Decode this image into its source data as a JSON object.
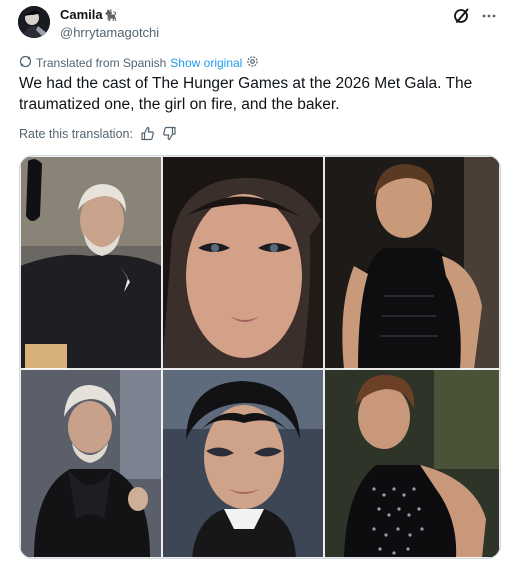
{
  "post": {
    "author": {
      "display_name": "Camila",
      "badge": "🐈‍⬛",
      "handle": "@hrrytamagotchi"
    },
    "icons": {
      "grok": "grok-icon",
      "more": "more-horizontal-icon",
      "translate": "translate-icon",
      "settings": "gear-icon",
      "thumbs_up": "thumbs-up-icon",
      "thumbs_down": "thumbs-down-icon"
    },
    "translation": {
      "label": "Translated from Spanish",
      "show_original": "Show original"
    },
    "text": "We had the cast of The Hunger Games at the 2026 Met Gala. The traumatized one, the girl on fire, and the baker.",
    "rate": {
      "label": "Rate this translation:"
    },
    "media": {
      "image_count": 6
    }
  },
  "colors": {
    "text": "#0f1419",
    "secondary": "#536471",
    "link": "#1d9bf0",
    "border": "#cfd9de"
  }
}
